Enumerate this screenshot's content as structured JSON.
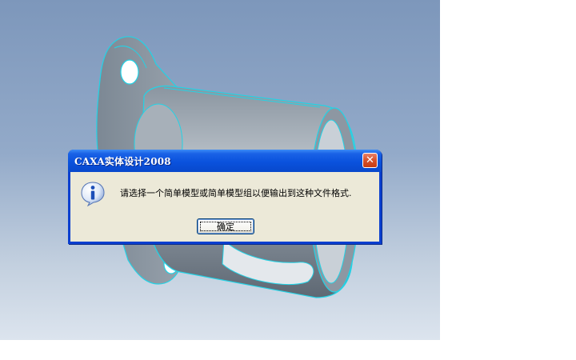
{
  "dialog": {
    "title": "CAXA实体设计2008",
    "close_label": "✕",
    "message": "请选择一个简单模型或简单模型组以便输出到这种文件格式.",
    "ok_label": "确定",
    "icon": "info-icon"
  },
  "colors": {
    "title_bar": "#0a52dd",
    "dialog_body": "#ece9d8",
    "close_button": "#d9542e",
    "viewport_top": "#7d97bb",
    "viewport_bottom": "#dce4ee",
    "model_edge": "#22d3e6"
  }
}
